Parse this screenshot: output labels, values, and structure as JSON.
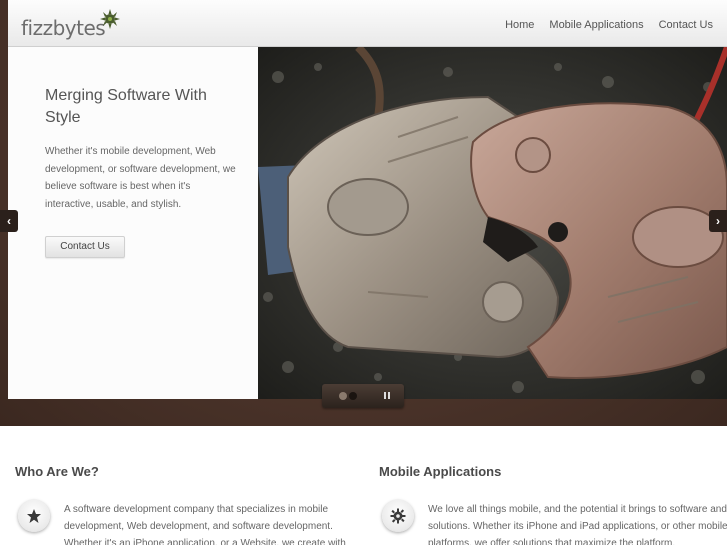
{
  "brand": {
    "logo_text": "fizzbytes",
    "logo_icon": "gear-leaf-icon"
  },
  "nav": {
    "items": [
      {
        "label": "Home"
      },
      {
        "label": "Mobile Applications"
      },
      {
        "label": "Contact Us"
      }
    ]
  },
  "hero": {
    "title": "Merging Software With Style",
    "text": "Whether it's mobile development, Web development, or software development, we believe software is best when it's interactive, usable, and stylish.",
    "button_label": "Contact Us",
    "image_subject": "rail-coupler-photo"
  },
  "slider": {
    "prev_icon": "chevron-left-icon",
    "next_icon": "chevron-right-icon",
    "pause_icon": "pause-icon",
    "slide_count": 2,
    "active_slide": 2
  },
  "sections": {
    "who": {
      "title": "Who Are We?",
      "icon": "star-icon",
      "text": "A software development company that specializes in mobile development, Web development, and software development. Whether it's an iPhone application, or a Website, we create with"
    },
    "mobile": {
      "title": "Mobile Applications",
      "icon": "gear-icon",
      "text": "We love all things mobile, and the potential it brings to software and solutions. Whether its iPhone and iPad applications, or other mobile platforms, we offer solutions that maximize the platform."
    }
  },
  "colors": {
    "background_brown": "#4d352b",
    "header_bg": "#f2f2f2",
    "text_gray": "#555555"
  }
}
